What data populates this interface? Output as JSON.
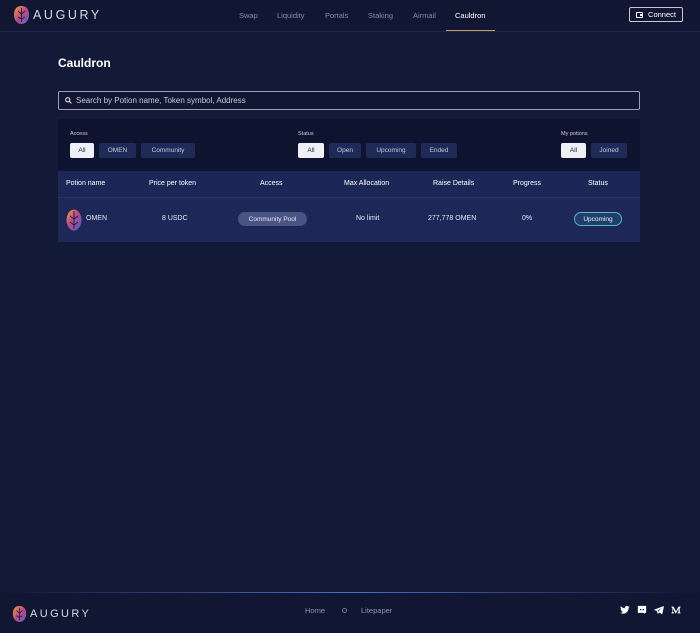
{
  "brand": {
    "name": "AUGURY"
  },
  "nav": {
    "items": [
      "Swap",
      "Liquidity",
      "Portals",
      "Staking",
      "Airmail",
      "Cauldron"
    ],
    "active": "Cauldron"
  },
  "header": {
    "connect_label": "Connect"
  },
  "page": {
    "title": "Cauldron"
  },
  "search": {
    "placeholder": "Search by Potion name, Token symbol, Address"
  },
  "filters": {
    "access": {
      "label": "Access",
      "options": [
        "All",
        "OMEN",
        "Community"
      ],
      "selected": "All"
    },
    "status": {
      "label": "Status",
      "options": [
        "All",
        "Open",
        "Upcoming",
        "Ended"
      ],
      "selected": "All"
    },
    "my_potions": {
      "label": "My potions",
      "options": [
        "All",
        "Joined"
      ],
      "selected": "All"
    }
  },
  "table": {
    "columns": [
      "Potion name",
      "Price per token",
      "Access",
      "Max Allocation",
      "Raise Details",
      "Progress",
      "Status"
    ],
    "rows": [
      {
        "potion_name": "OMEN",
        "price_per_token": "8 USDC",
        "access": "Community Pool",
        "max_allocation": "No limit",
        "raise_details": "277,778 OMEN",
        "progress": "0%",
        "status": "Upcoming"
      }
    ]
  },
  "footer": {
    "links": [
      "Home",
      "Litepaper"
    ],
    "socials": [
      "twitter-icon",
      "discord-icon",
      "telegram-icon",
      "medium-icon"
    ]
  },
  "colors": {
    "background": "#131a38",
    "panel": "#0e1430",
    "table_row": "#1d2858",
    "accent_underline": "#c99a52",
    "status_border": "#5fb0c8"
  }
}
